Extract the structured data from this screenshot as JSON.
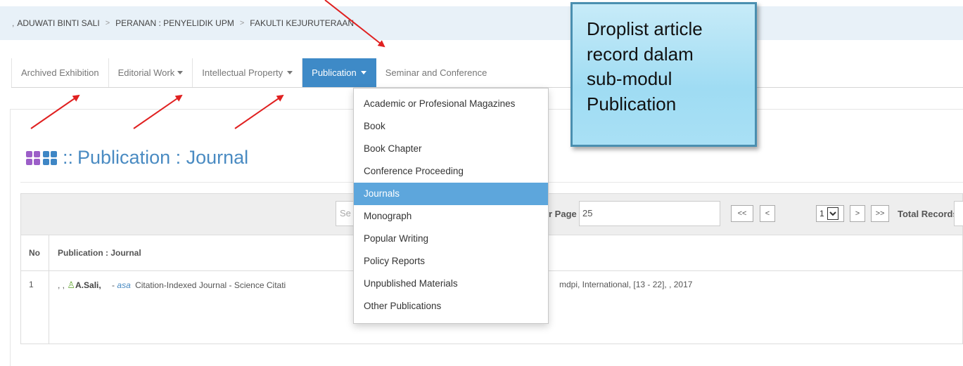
{
  "breadcrumb": {
    "items": [
      "ADUWATI BINTI SALI",
      "PERANAN : PENYELIDIK UPM",
      "FAKULTI KEJURUTERAAN"
    ],
    "prefix": ",",
    "separator": ">"
  },
  "tabs": [
    {
      "label": "Archived Exhibition",
      "has_caret": false
    },
    {
      "label": "Editorial Work",
      "has_caret": true
    },
    {
      "label": "Intellectual Property",
      "has_caret": true
    },
    {
      "label": "Publication",
      "has_caret": true,
      "active": true
    },
    {
      "label": "Seminar and Conference",
      "has_caret": false
    }
  ],
  "page": {
    "title": "Publication : Journal",
    "title_prefix": "::"
  },
  "toolbar": {
    "search_placeholder": "Se",
    "per_page_label": "r Page",
    "per_page_value": "25",
    "pager_buttons": [
      "<<",
      "<",
      ">",
      ">>"
    ],
    "page_select_value": "1",
    "total_records_label": "Total Records"
  },
  "table": {
    "headers": [
      "No",
      "Publication : Journal"
    ],
    "rows": [
      {
        "no": "1",
        "prefix": ", ,",
        "author": "A.Sali,",
        "dash": "-",
        "abbr": "asa",
        "text": "Citation-Indexed Journal - Science Citati",
        "tail": "mdpi,  International,  [13 - 22], ,  2017"
      }
    ]
  },
  "dropdown": {
    "items": [
      "Academic or Profesional Magazines",
      "Book",
      "Book Chapter",
      "Conference Proceeding",
      "Journals",
      "Monograph",
      "Popular Writing",
      "Policy Reports",
      "Unpublished Materials",
      "Other Publications"
    ],
    "highlighted_index": 4
  },
  "callout": {
    "lines": [
      "Droplist article",
      "record dalam",
      "sub-modul",
      "Publication"
    ]
  },
  "colors": {
    "accent": "#3e8ac7",
    "highlight": "#5da6dc",
    "breadcrumb_bg": "#e8f1f8",
    "arrow": "#e02020",
    "callout_bg": "#a9e0f5"
  }
}
